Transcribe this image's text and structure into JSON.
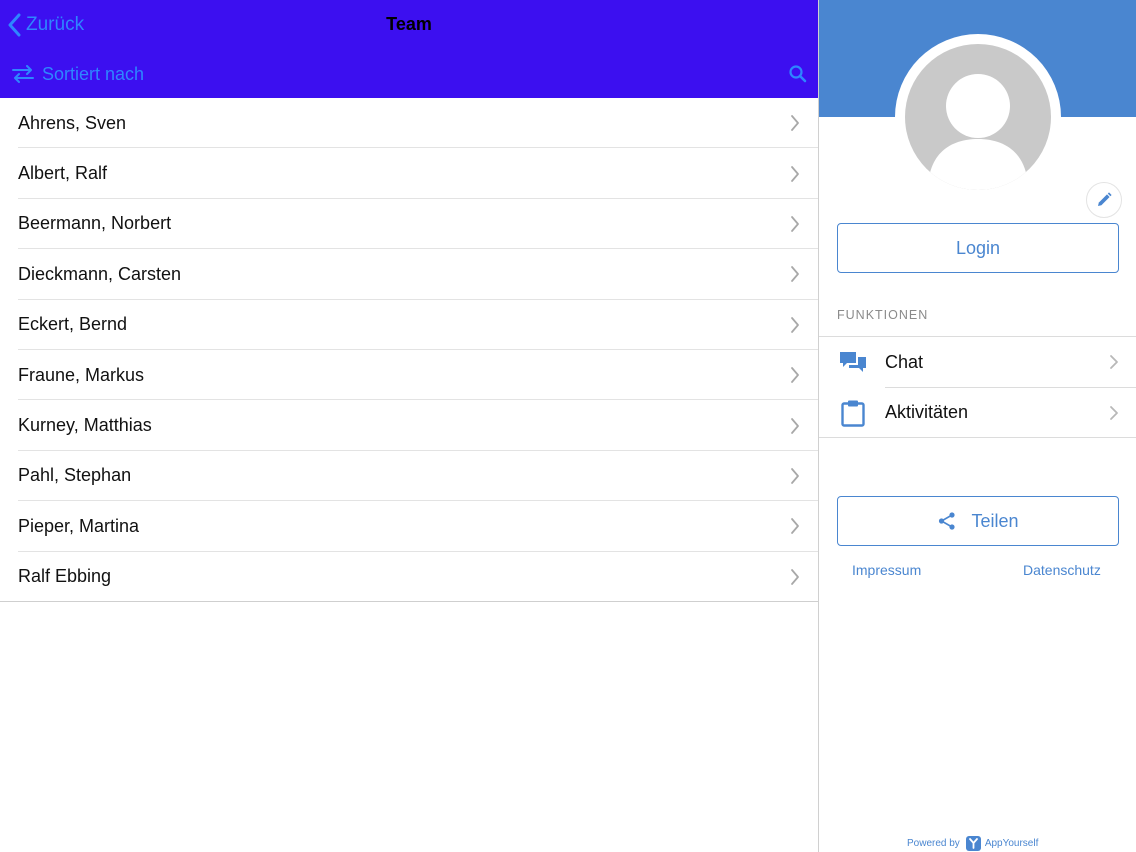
{
  "header": {
    "back_label": "Zurück",
    "title": "Team",
    "sort_label": "Sortiert nach",
    "icons": {
      "back": "chevron-left-icon",
      "sort": "swap-arrows-icon",
      "search": "search-icon"
    }
  },
  "team": {
    "members": [
      {
        "name": "Ahrens, Sven"
      },
      {
        "name": "Albert, Ralf"
      },
      {
        "name": "Beermann, Norbert"
      },
      {
        "name": "Dieckmann, Carsten"
      },
      {
        "name": "Eckert, Bernd"
      },
      {
        "name": "Fraune, Markus"
      },
      {
        "name": "Kurney, Matthias"
      },
      {
        "name": "Pahl, Stephan"
      },
      {
        "name": "Pieper, Martina"
      },
      {
        "name": "Ralf Ebbing"
      }
    ]
  },
  "sidebar": {
    "login_label": "Login",
    "section_label": "FUNKTIONEN",
    "functions": [
      {
        "label": "Chat",
        "icon": "chat-bubbles-icon"
      },
      {
        "label": "Aktivitäten",
        "icon": "clipboard-icon"
      }
    ],
    "share_label": "Teilen",
    "impressum_label": "Impressum",
    "datenschutz_label": "Datenschutz",
    "powered_by": "Powered by",
    "brand": "AppYourself"
  },
  "colors": {
    "topbar": "#3c0ff0",
    "link_blue": "#2e86ff",
    "accent": "#4a86d0",
    "avatar_gray": "#c9c9c9"
  }
}
